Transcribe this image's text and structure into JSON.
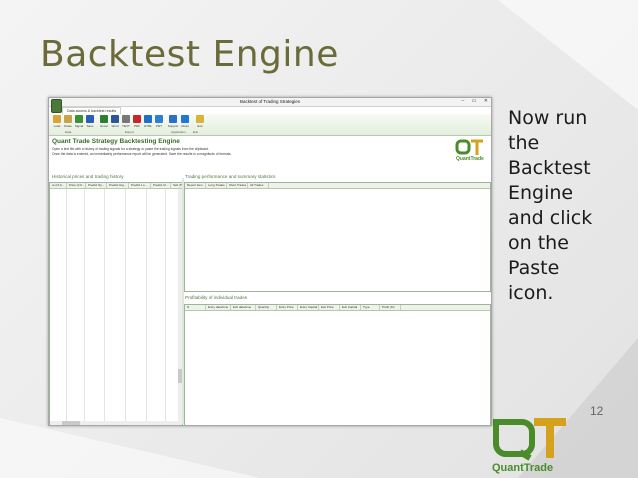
{
  "slide": {
    "title": "Backtest Engine",
    "body_lines": [
      "Now run",
      "the",
      "Backtest",
      "Engine",
      "and click",
      "on the",
      "Paste",
      "icon."
    ],
    "page_number": "12"
  },
  "logo": {
    "letters": "QT",
    "text": "QuantTrade"
  },
  "app": {
    "window_title": "Backtest of Trading Strategies",
    "window_controls": [
      "–",
      "▭",
      "✕"
    ],
    "ribbon_tab": "Data access & backtest results",
    "buttons": [
      {
        "label": "Load",
        "icon": "folder-icon",
        "color": "#d9a53a"
      },
      {
        "label": "Paste",
        "icon": "paste-icon",
        "color": "#c9a24a"
      },
      {
        "label": "Signal",
        "icon": "check-icon",
        "color": "#3e8f3a"
      },
      {
        "label": "Save",
        "icon": "save-icon",
        "color": "#2a5fb3"
      },
      {
        "label": "Excel",
        "icon": "excel-icon",
        "color": "#2e7d32"
      },
      {
        "label": "Word",
        "icon": "word-icon",
        "color": "#2b579a"
      },
      {
        "label": "TEXT",
        "icon": "text-icon",
        "color": "#777777"
      },
      {
        "label": "PDF",
        "icon": "pdf-icon",
        "color": "#c62828"
      },
      {
        "label": "HTML",
        "icon": "html-icon",
        "color": "#1e6fc8"
      },
      {
        "label": "PRT",
        "icon": "print-icon",
        "color": "#2f7fd0"
      },
      {
        "label": "Support",
        "icon": "support-icon",
        "color": "#2c6ec8"
      },
      {
        "label": "About",
        "icon": "about-icon",
        "color": "#1f78d1"
      },
      {
        "label": "Exit",
        "icon": "exit-icon",
        "color": "#d8b43a"
      }
    ],
    "groups": [
      "Data",
      "Export",
      "Application",
      "Exit"
    ],
    "heading": "Quant Trade Strategy Backtesting Engine",
    "desc_line1": "Open a text file with a history of trading signals for a strategy or paste the trading signals from the clipboard.",
    "desc_line2": "Once the data is entered, an immediately performance report will be generated. Save the results in a magnitude of formats.",
    "left_section": "Historical prices and trading history",
    "left_columns": [
      "te (CU)...",
      "Price (CU...",
      "Predict Sp...",
      "Predict Hig...",
      "Predict Lo...",
      "Predict Cl...",
      "Sell (Prev"
    ],
    "right_section": "Trading performance and summary statistics",
    "right_columns": [
      "Report Item",
      "Long Trades",
      "Short Trades",
      "All Trades"
    ],
    "bottom_section": "Profitability of individual trades",
    "bottom_columns": [
      "N",
      "Entry date/time",
      "Exit date/time",
      "Quantity",
      "Entry Price",
      "Entry Capital",
      "Exit Price",
      "Exit Capital",
      "Type",
      "Profit (%)"
    ]
  },
  "colors": {
    "accent": "#3a6b2a",
    "title": "#6b6b3a",
    "logo_green": "#4a8c2a",
    "logo_gold": "#d4a21c"
  }
}
